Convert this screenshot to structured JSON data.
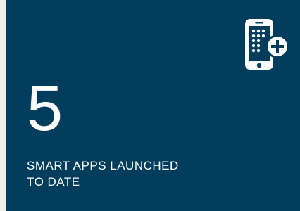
{
  "card": {
    "background_color": "#003d5c",
    "text_color": "#ffffff",
    "icon": "smartphone-add-icon",
    "number": "5",
    "label_lines": [
      "SMART APPS LAUNCHED",
      "TO DATE"
    ]
  }
}
